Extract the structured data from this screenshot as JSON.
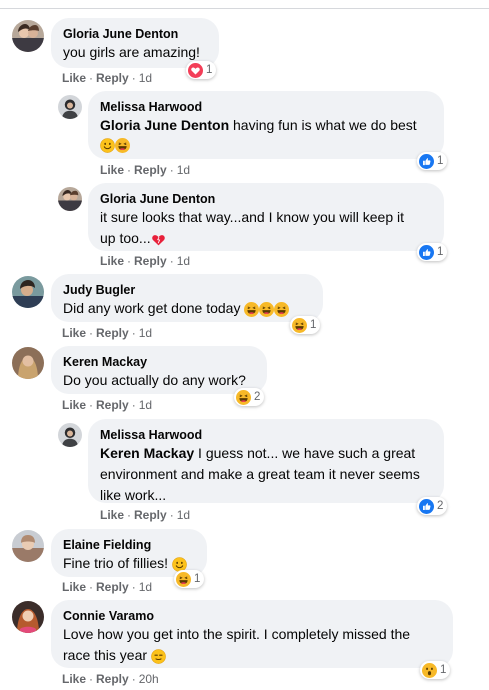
{
  "action_like": "Like",
  "action_reply": "Reply",
  "comments": [
    {
      "name": "Gloria June Denton",
      "text": "you girls are amazing!",
      "time": "1d",
      "reaction": "love",
      "reaction_count": "1"
    },
    {
      "name": "Melissa Harwood",
      "mention": "Gloria June Denton",
      "text": " having fun is what we do best",
      "time": "1d",
      "reaction": "like",
      "reaction_count": "1"
    },
    {
      "name": "Gloria June Denton",
      "text_line1": "it sure looks that way...and I know you will keep it",
      "text_line2": "up too...",
      "time": "1d",
      "reaction": "like",
      "reaction_count": "1"
    },
    {
      "name": "Judy Bugler",
      "text": "Did any work get done today",
      "time": "1d",
      "reaction": "haha",
      "reaction_count": "1"
    },
    {
      "name": "Keren Mackay",
      "text": "Do you actually do any work?",
      "time": "1d",
      "reaction": "haha",
      "reaction_count": "2"
    },
    {
      "name": "Melissa Harwood",
      "mention": "Keren Mackay",
      "text_line1": " I guess not... we have such a great",
      "text_line2": "environment and make a great team it never seems",
      "text_line3": "like work...",
      "time": "1d",
      "reaction": "like",
      "reaction_count": "2"
    },
    {
      "name": "Elaine Fielding",
      "text": "Fine trio of fillies!",
      "time": "1d",
      "reaction": "haha",
      "reaction_count": "1"
    },
    {
      "name": "Connie Varamo",
      "text_line1": "Love how you get into the spirit. I completely missed the",
      "text_line2": "race this year",
      "time": "20h",
      "reaction": "wow",
      "reaction_count": "1"
    }
  ]
}
